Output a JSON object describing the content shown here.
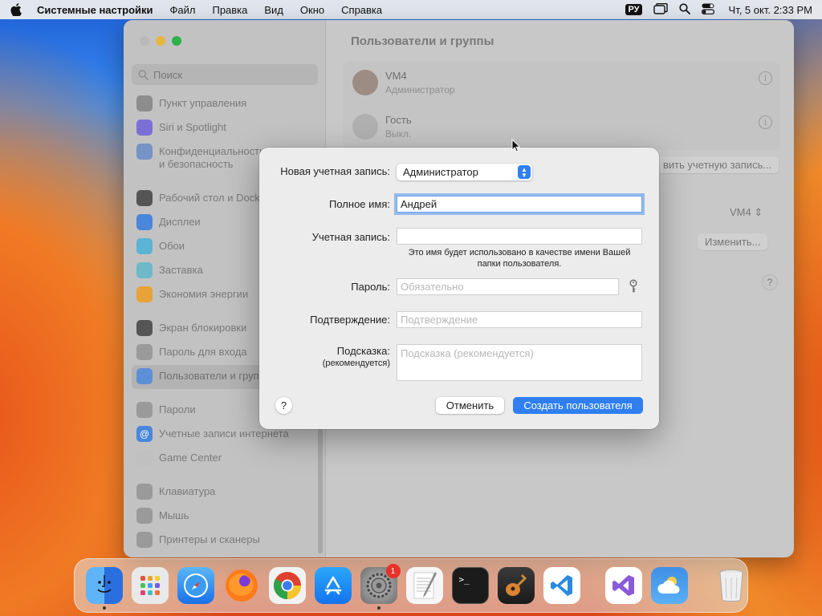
{
  "menubar": {
    "app_name": "Системные настройки",
    "items": [
      "Файл",
      "Правка",
      "Вид",
      "Окно",
      "Справка"
    ],
    "input_lang": "РУ",
    "datetime": "Чт, 5 окт.  2:33 PM"
  },
  "window": {
    "title": "Пользователи и группы",
    "search_placeholder": "Поиск"
  },
  "sidebar": {
    "items": [
      {
        "label": "Пункт управления",
        "color": "#8d8d8d",
        "icon": "control-center-icon"
      },
      {
        "label": "Siri и Spotlight",
        "color": "#7d6ed6",
        "icon": "siri-icon"
      },
      {
        "label": "Конфиденциальность и безопасность",
        "color": "#7593c4",
        "icon": "privacy-hand-icon"
      },
      {
        "label": "Рабочий стол и Dock",
        "color": "#555555",
        "icon": "desktop-dock-icon"
      },
      {
        "label": "Дисплеи",
        "color": "#4a86d9",
        "icon": "display-icon"
      },
      {
        "label": "Обои",
        "color": "#5bb3d6",
        "icon": "wallpaper-icon"
      },
      {
        "label": "Заставка",
        "color": "#6fb8c9",
        "icon": "screensaver-icon"
      },
      {
        "label": "Экономия энергии",
        "color": "#e8a23a",
        "icon": "energy-icon"
      },
      {
        "label": "Экран блокировки",
        "color": "#555555",
        "icon": "lock-screen-icon"
      },
      {
        "label": "Пароль для входа",
        "color": "#9a9a9a",
        "icon": "lock-icon"
      },
      {
        "label": "Пользователи и группы",
        "color": "#5d8fd6",
        "icon": "users-groups-icon"
      },
      {
        "label": "Пароли",
        "color": "#9a9a9a",
        "icon": "key-icon"
      },
      {
        "label": "Учетные записи интернета",
        "color": "#4a86d9",
        "icon": "at-icon"
      },
      {
        "label": "Game Center",
        "color": "#c0c0c0",
        "icon": "game-center-icon"
      },
      {
        "label": "Клавиатура",
        "color": "#9a9a9a",
        "icon": "keyboard-icon"
      },
      {
        "label": "Мышь",
        "color": "#9a9a9a",
        "icon": "mouse-icon"
      },
      {
        "label": "Принтеры и сканеры",
        "color": "#9a9a9a",
        "icon": "printer-icon"
      }
    ]
  },
  "users": [
    {
      "name": "VM4",
      "role": "Администратор"
    },
    {
      "name": "Гость",
      "role": "Выкл."
    }
  ],
  "background_controls": {
    "add_account": "вить учетную запись...",
    "autologin_value": "VM4",
    "edit_button": "Изменить...",
    "help": "?"
  },
  "dialog": {
    "account_type_label": "Новая учетная запись:",
    "account_type_value": "Администратор",
    "full_name_label": "Полное имя:",
    "full_name_value": "Андрей",
    "account_label": "Учетная запись:",
    "account_value": "",
    "account_hint_line1": "Это имя будет использовано в качестве имени Вашей",
    "account_hint_line2": "папки пользователя.",
    "password_label": "Пароль:",
    "password_placeholder": "Обязательно",
    "verify_label": "Подтверждение:",
    "verify_placeholder": "Подтверждение",
    "hint_label": "Подсказка:",
    "hint_label_sub": "(рекомендуется)",
    "hint_placeholder": "Подсказка (рекомендуется)",
    "help_button": "?",
    "cancel_button": "Отменить",
    "create_button": "Создать пользователя"
  },
  "dock": {
    "apps": [
      {
        "name": "finder",
        "color": "#3d8ff2",
        "running": true
      },
      {
        "name": "launchpad",
        "color": "#e9e9e9",
        "running": false
      },
      {
        "name": "safari",
        "color": "#2d8df3",
        "running": false
      },
      {
        "name": "firefox",
        "color": "#ff6d2a",
        "running": false
      },
      {
        "name": "chrome",
        "color": "#f2f2f2",
        "running": false
      },
      {
        "name": "app-store",
        "color": "#1f8cf5",
        "running": false
      },
      {
        "name": "system-settings",
        "color": "#8a8a8a",
        "running": true,
        "badge": "1"
      },
      {
        "name": "textedit",
        "color": "#f4f4f4",
        "running": false
      },
      {
        "name": "terminal",
        "color": "#1b1b1b",
        "running": false
      },
      {
        "name": "garageband",
        "color": "#2b2b2b",
        "running": false
      },
      {
        "name": "vscode",
        "color": "#ffffff",
        "running": false
      },
      {
        "name": "visual-studio",
        "color": "#ffffff",
        "running": false
      },
      {
        "name": "weather",
        "color": "#3f8fe6",
        "running": false
      },
      {
        "name": "trash",
        "color": "#dcdcdc",
        "running": false
      }
    ]
  }
}
